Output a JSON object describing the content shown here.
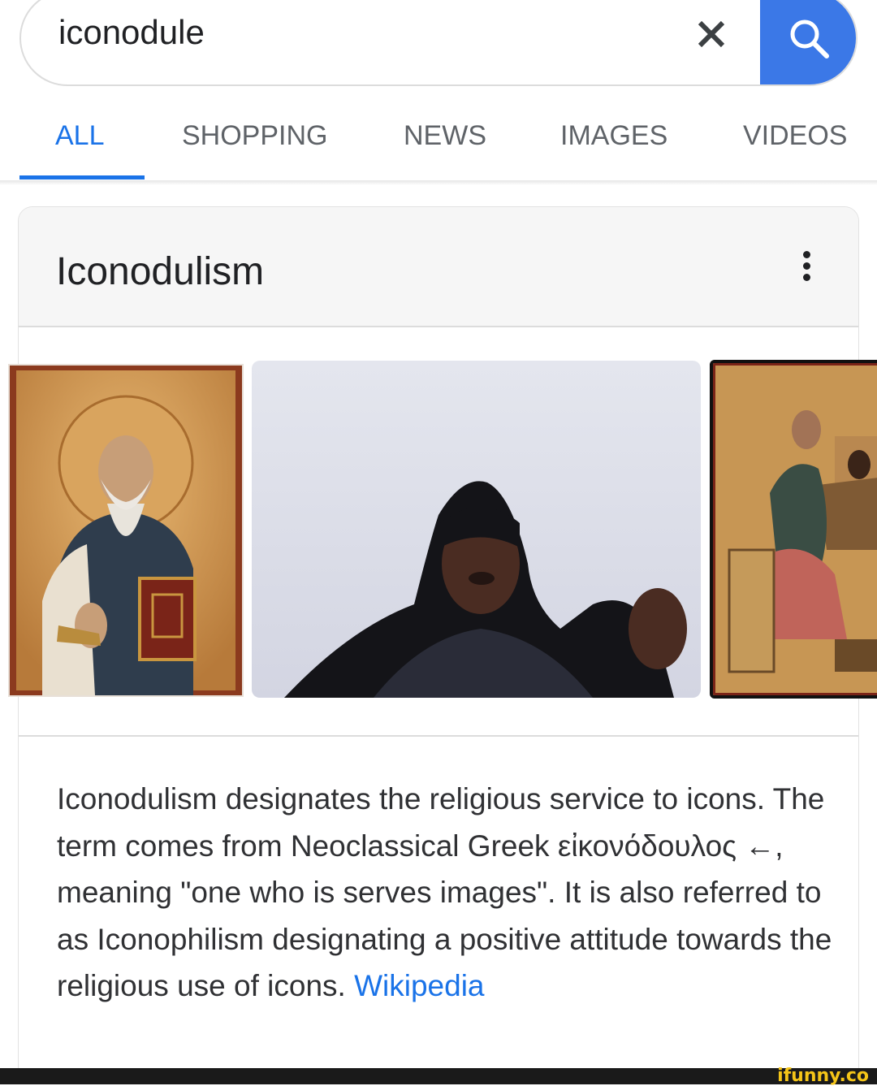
{
  "search": {
    "query": "iconodule",
    "clear_icon": "close-icon",
    "search_icon": "search-icon",
    "accent": "#3b78e7"
  },
  "tabs": [
    {
      "label": "ALL",
      "active": true
    },
    {
      "label": "SHOPPING",
      "active": false
    },
    {
      "label": "NEWS",
      "active": false
    },
    {
      "label": "IMAGES",
      "active": false
    },
    {
      "label": "VIDEOS",
      "active": false
    }
  ],
  "card": {
    "title": "Iconodulism",
    "more_icon": "more-vert-icon",
    "description": "Iconodulism designates the religious service to icons. The term comes from Neoclassical Greek εἰκονόδουλος ←, meaning \"one who is serves images\". It is also referred to as Iconophilism designating a positive attitude towards the religious use of icons.",
    "source_link": "Wikipedia",
    "images": [
      {
        "name": "saint-icon-painting"
      },
      {
        "name": "woman-webcam-photo"
      },
      {
        "name": "evangelist-icon-painting"
      }
    ]
  },
  "watermark": "ifunny.co",
  "colors": {
    "link": "#1a73e8",
    "tab_inactive": "#5f6368",
    "text": "#202124"
  }
}
